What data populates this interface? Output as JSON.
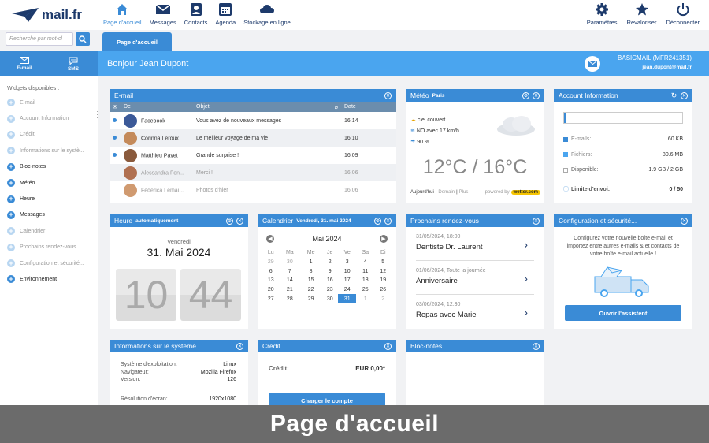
{
  "app": {
    "brand": "mail.fr"
  },
  "nav": [
    {
      "label": "Page d'accueil",
      "icon": "home-icon",
      "active": true
    },
    {
      "label": "Messages",
      "icon": "envelope-icon"
    },
    {
      "label": "Contacts",
      "icon": "contacts-icon"
    },
    {
      "label": "Agenda",
      "icon": "calendar-icon"
    },
    {
      "label": "Stockage en ligne",
      "icon": "cloud-icon"
    }
  ],
  "nav_right": [
    {
      "label": "Paramètres",
      "icon": "gear-icon"
    },
    {
      "label": "Revaloriser",
      "icon": "star-icon"
    },
    {
      "label": "Déconnecter",
      "icon": "power-icon"
    }
  ],
  "search": {
    "placeholder": "Recherche par mot-cl"
  },
  "active_tab": "Page d'accueil",
  "quick": {
    "email": "E-mail",
    "sms": "SMS"
  },
  "greeting": "Bonjour Jean Dupont",
  "account": {
    "plan": "BASICMAIL (MFR241351)",
    "email": "jean.dupont@mail.fr"
  },
  "sidebar": {
    "title": "Widgets disponibles :",
    "items": [
      {
        "label": "E-mail",
        "enabled": false
      },
      {
        "label": "Account Information",
        "enabled": false
      },
      {
        "label": "Crédit",
        "enabled": false
      },
      {
        "label": "Informations sur le systè...",
        "enabled": false
      },
      {
        "label": "Bloc-notes",
        "enabled": true
      },
      {
        "label": "Météo",
        "enabled": true
      },
      {
        "label": "Heure",
        "enabled": true
      },
      {
        "label": "Messages",
        "enabled": true
      },
      {
        "label": "Calendrier",
        "enabled": false
      },
      {
        "label": "Prochains rendez-vous",
        "enabled": false
      },
      {
        "label": "Configuration et sécurité...",
        "enabled": false
      },
      {
        "label": "Environnement",
        "enabled": true
      }
    ]
  },
  "email": {
    "title": "E-mail",
    "cols": [
      "De",
      "Objet",
      "Date"
    ],
    "rows": [
      {
        "from": "Facebook",
        "subject": "Vous avez de nouveaux messages",
        "date": "16:14",
        "unread": true,
        "avatar": "#3b5998"
      },
      {
        "from": "Corinna Leroux",
        "subject": "Le meilleur voyage de ma vie",
        "date": "16:10",
        "unread": true,
        "avatar": "#c48a5a"
      },
      {
        "from": "Matthieu Payet",
        "subject": "Grande surprise !",
        "date": "16:09",
        "unread": true,
        "avatar": "#8a5a3c"
      },
      {
        "from": "Alessandra Fon...",
        "subject": "Merci !",
        "date": "16:06",
        "unread": false,
        "avatar": "#b07050"
      },
      {
        "from": "Federica Lemai...",
        "subject": "Photos d'hier",
        "date": "16:06",
        "unread": false,
        "avatar": "#d09a70"
      }
    ]
  },
  "meteo": {
    "title": "Météo",
    "city": "Paris",
    "cond1": "ciel couvert",
    "cond2": "NO avec 17 km/h",
    "cond3": "90 %",
    "temp": "12°C / 16°C",
    "days": [
      "Aujourd'hui",
      "Demain",
      "Plus"
    ],
    "powered": "powered by",
    "provider": "wetter.com"
  },
  "accinfo": {
    "title": "Account Information",
    "usage_fraction": 0.01,
    "rows": [
      {
        "label": "E-mails:",
        "value": "60 KB"
      },
      {
        "label": "Fichiers:",
        "value": "80.6 MB"
      },
      {
        "label": "Disponible:",
        "value": "1.9 GB / 2 GB"
      }
    ],
    "limit_label": "Limite d'envoi:",
    "limit_value": "0 / 50"
  },
  "heure": {
    "title": "Heure",
    "sub": "automatiquement",
    "day": "Vendredi",
    "date": "31. Mai 2024",
    "h": "10",
    "m": "44"
  },
  "calendar": {
    "title": "Calendrier",
    "sub": "Vendredi, 31. mai 2024",
    "month": "Mai 2024",
    "days": [
      "Lu",
      "Ma",
      "Me",
      "Je",
      "Ve",
      "Sa",
      "Di"
    ],
    "weeks": [
      [
        "29",
        "30",
        "1",
        "2",
        "3",
        "4",
        "5"
      ],
      [
        "6",
        "7",
        "8",
        "9",
        "10",
        "11",
        "12"
      ],
      [
        "13",
        "14",
        "15",
        "16",
        "17",
        "18",
        "19"
      ],
      [
        "20",
        "21",
        "22",
        "23",
        "24",
        "25",
        "26"
      ],
      [
        "27",
        "28",
        "29",
        "30",
        "31",
        "1",
        "2"
      ]
    ]
  },
  "rdv": {
    "title": "Prochains rendez-vous",
    "items": [
      {
        "date": "31/05/2024, 18:00",
        "title": "Dentiste Dr. Laurent"
      },
      {
        "date": "01/06/2024, Toute la journée",
        "title": "Anniversaire"
      },
      {
        "date": "03/06/2024, 12:30",
        "title": "Repas avec Marie"
      }
    ]
  },
  "config": {
    "title": "Configuration et sécurité...",
    "text": "Configurez votre nouvelle boîte e-mail et importez entre autres e-mails & et contacts de votre boîte e-mail actuelle !",
    "button": "Ouvrir l'assistent"
  },
  "sysinfo": {
    "title": "Informations sur le système",
    "rows": [
      {
        "label": "Système d'exploitation:",
        "value": "Linux"
      },
      {
        "label": "Navigateur:",
        "value": "Mozilla Firefox"
      },
      {
        "label": "Version:",
        "value": "126"
      }
    ],
    "res_label": "Résolution d'écran:",
    "res_value": "1920x1080"
  },
  "credit": {
    "title": "Crédit",
    "label": "Crédit:",
    "value": "EUR 0,00*",
    "button": "Charger le compte"
  },
  "notes": {
    "title": "Bloc-notes"
  },
  "caption": "Page d'accueil",
  "colors": {
    "primary": "#3a8bd6",
    "light": "#4aa5ef",
    "dark": "#1d3a6b"
  }
}
